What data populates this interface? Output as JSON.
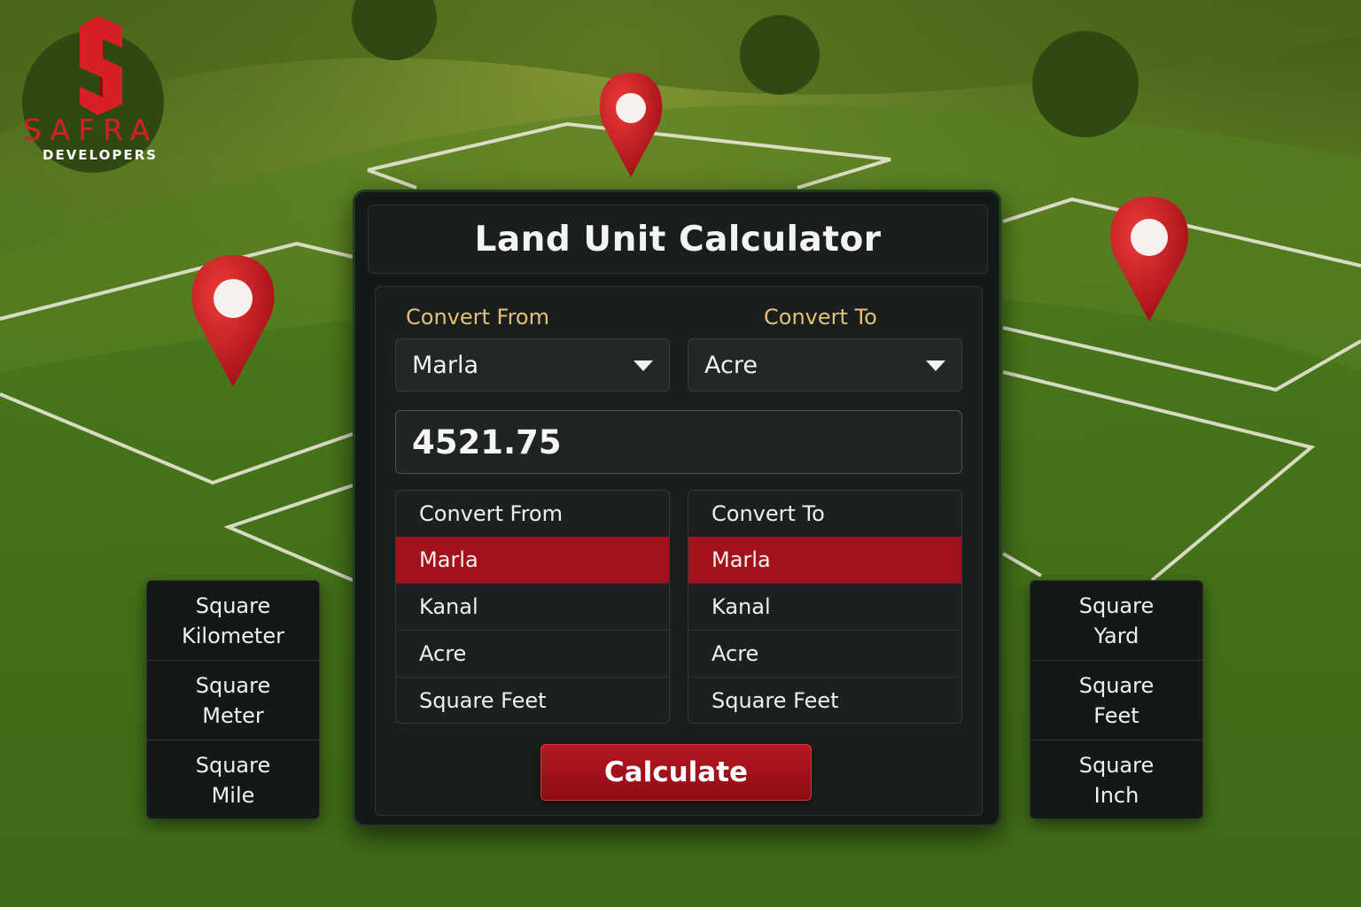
{
  "brand": {
    "name": "SAFRA",
    "tagline": "DEVELOPERS",
    "color": "#d81f26"
  },
  "calculator": {
    "title": "Land Unit Calculator",
    "convert_from_label": "Convert From",
    "convert_to_label": "Convert To",
    "from_selected": "Marla",
    "to_selected": "Acre",
    "input_value": "4521.75",
    "from_list": {
      "header": "Convert From",
      "items": [
        "Marla",
        "Kanal",
        "Acre",
        "Square Feet"
      ],
      "selected_index": 0
    },
    "to_list": {
      "header": "Convert To",
      "items": [
        "Marla",
        "Kanal",
        "Acre",
        "Square Feet"
      ],
      "selected_index": 0
    },
    "calculate_label": "Calculate",
    "accent_color": "#a3111a"
  },
  "left_units": [
    {
      "line1": "Square",
      "line2": "Kilometer"
    },
    {
      "line1": "Square",
      "line2": "Meter"
    },
    {
      "line1": "Square",
      "line2": "Mile"
    }
  ],
  "right_units": [
    {
      "line1": "Square",
      "line2": "Yard"
    },
    {
      "line1": "Square",
      "line2": "Feet"
    },
    {
      "line1": "Square",
      "line2": "Inch"
    }
  ],
  "icons": [
    "map-pin-icon",
    "caret-down-icon",
    "safra-logo-icon"
  ]
}
